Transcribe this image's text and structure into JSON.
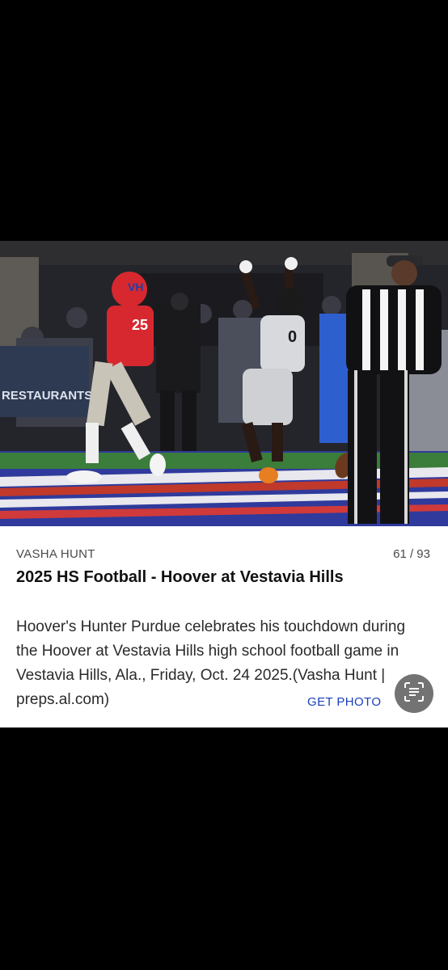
{
  "photo": {
    "scoreboard_text": "RESTAURANTS",
    "jersey_left_number": "25",
    "helmet_logo": "VH",
    "jersey_right_number": "0"
  },
  "caption": {
    "credit": "VASHA HUNT",
    "counter": "61 / 93",
    "title": "2025 HS Football - Hoover at Vestavia Hills",
    "description": "Hoover's Hunter Purdue celebrates his touchdown during the Hoover at Vestavia Hills high school football game in Vestavia Hills, Ala., Friday, Oct. 24 2025.(Vasha Hunt | preps.al.com)",
    "get_photo_label": "GET PHOTO"
  },
  "icons": {
    "lens": "text-scan-icon"
  },
  "colors": {
    "background": "#000000",
    "card": "#ffffff",
    "link": "#1a3fb8",
    "jersey_red": "#d7282f"
  }
}
